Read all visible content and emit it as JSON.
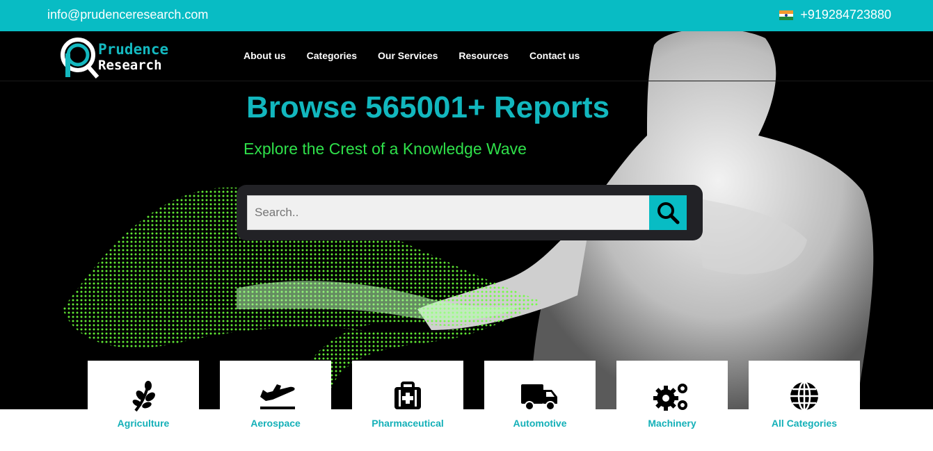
{
  "topbar": {
    "email": "info@prudenceresearch.com",
    "phone": "+919284723880"
  },
  "logo": {
    "line1": "Prudence",
    "line2": "Research"
  },
  "nav": [
    {
      "label": "About us"
    },
    {
      "label": "Categories"
    },
    {
      "label": "Our Services"
    },
    {
      "label": "Resources"
    },
    {
      "label": "Contact us"
    }
  ],
  "hero": {
    "title": "Browse 565001+ Reports",
    "subtitle": "Explore the Crest of a Knowledge Wave"
  },
  "search": {
    "placeholder": "Search.."
  },
  "categories": [
    {
      "label": "Agriculture",
      "icon": "plant-icon"
    },
    {
      "label": "Aerospace",
      "icon": "airplane-icon"
    },
    {
      "label": "Pharmaceutical",
      "icon": "medical-kit-icon"
    },
    {
      "label": "Automotive",
      "icon": "truck-icon"
    },
    {
      "label": "Machinery",
      "icon": "gears-icon"
    },
    {
      "label": "All Categories",
      "icon": "globe-icon"
    }
  ],
  "colors": {
    "accent": "#08bcc4",
    "subtitle": "#2fe04a",
    "hero_bg": "#000000"
  }
}
